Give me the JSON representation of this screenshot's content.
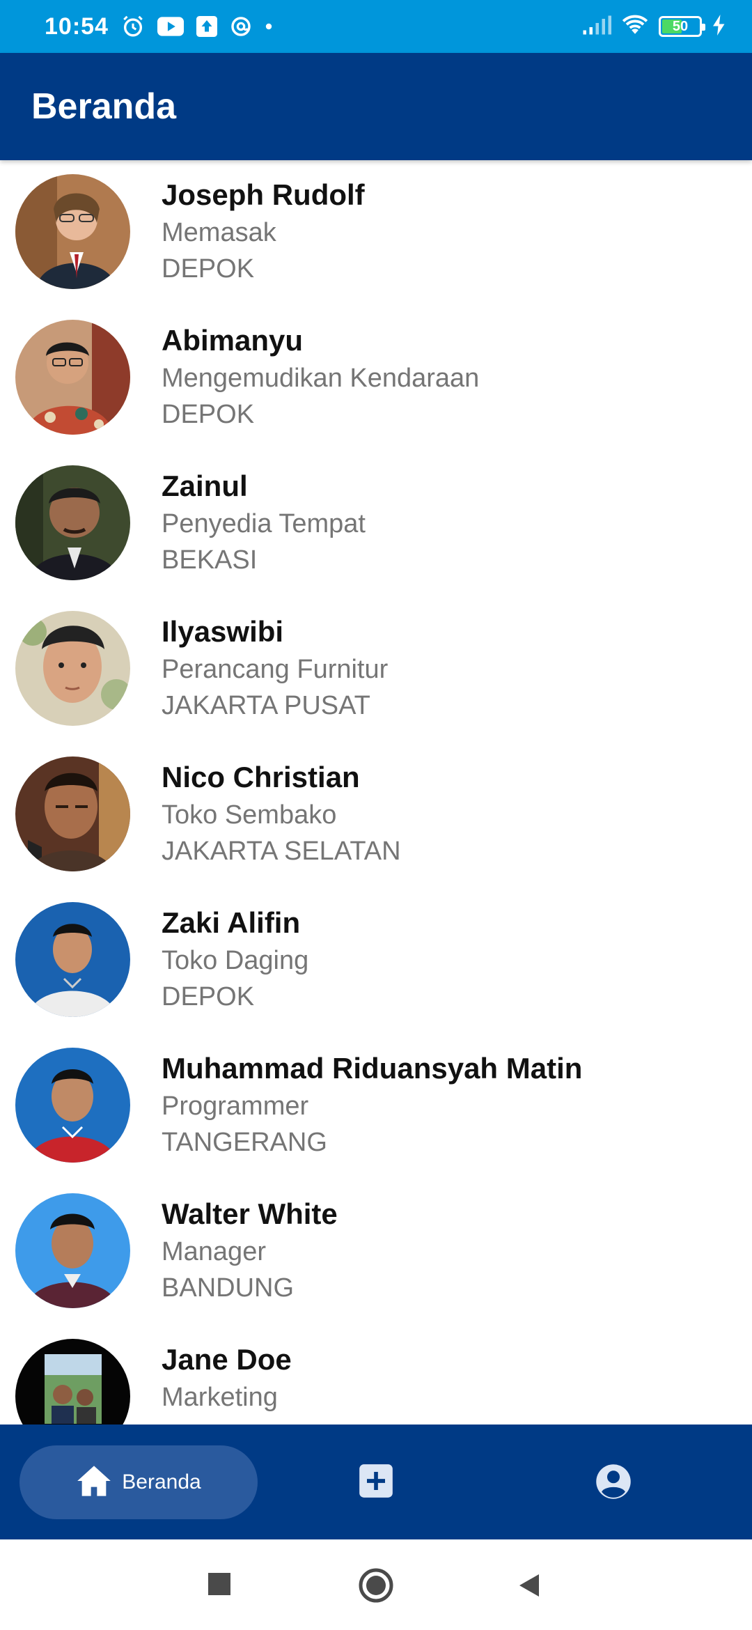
{
  "status_bar": {
    "time": "10:54",
    "battery": "50",
    "icons": [
      "alarm-icon",
      "youtube-icon",
      "upload-icon",
      "at-sign-icon",
      "dot-icon",
      "signal-icon",
      "wifi-icon",
      "battery-icon",
      "charging-icon"
    ]
  },
  "app_bar": {
    "title": "Beranda"
  },
  "people": [
    {
      "name": "Joseph Rudolf",
      "role": "Memasak",
      "city": "DEPOK"
    },
    {
      "name": "Abimanyu",
      "role": "Mengemudikan Kendaraan",
      "city": "DEPOK"
    },
    {
      "name": "Zainul",
      "role": "Penyedia Tempat",
      "city": "BEKASI"
    },
    {
      "name": "Ilyaswibi",
      "role": "Perancang Furnitur",
      "city": "JAKARTA PUSAT"
    },
    {
      "name": "Nico Christian",
      "role": "Toko Sembako",
      "city": "JAKARTA SELATAN"
    },
    {
      "name": "Zaki Alifin",
      "role": "Toko Daging",
      "city": "DEPOK"
    },
    {
      "name": "Muhammad Riduansyah Matin",
      "role": "Programmer",
      "city": "TANGERANG"
    },
    {
      "name": "Walter White",
      "role": "Manager",
      "city": "BANDUNG"
    },
    {
      "name": "Jane Doe",
      "role": "Marketing",
      "city": ""
    }
  ],
  "bottom_nav": {
    "home_label": "Beranda",
    "add_icon": "add-box-icon",
    "profile_icon": "account-circle-icon"
  },
  "colors": {
    "status_bar": "#0096DB",
    "app_bar": "#003A85",
    "nav_active_pill": "#2A5A9E",
    "secondary_text": "#757575"
  }
}
